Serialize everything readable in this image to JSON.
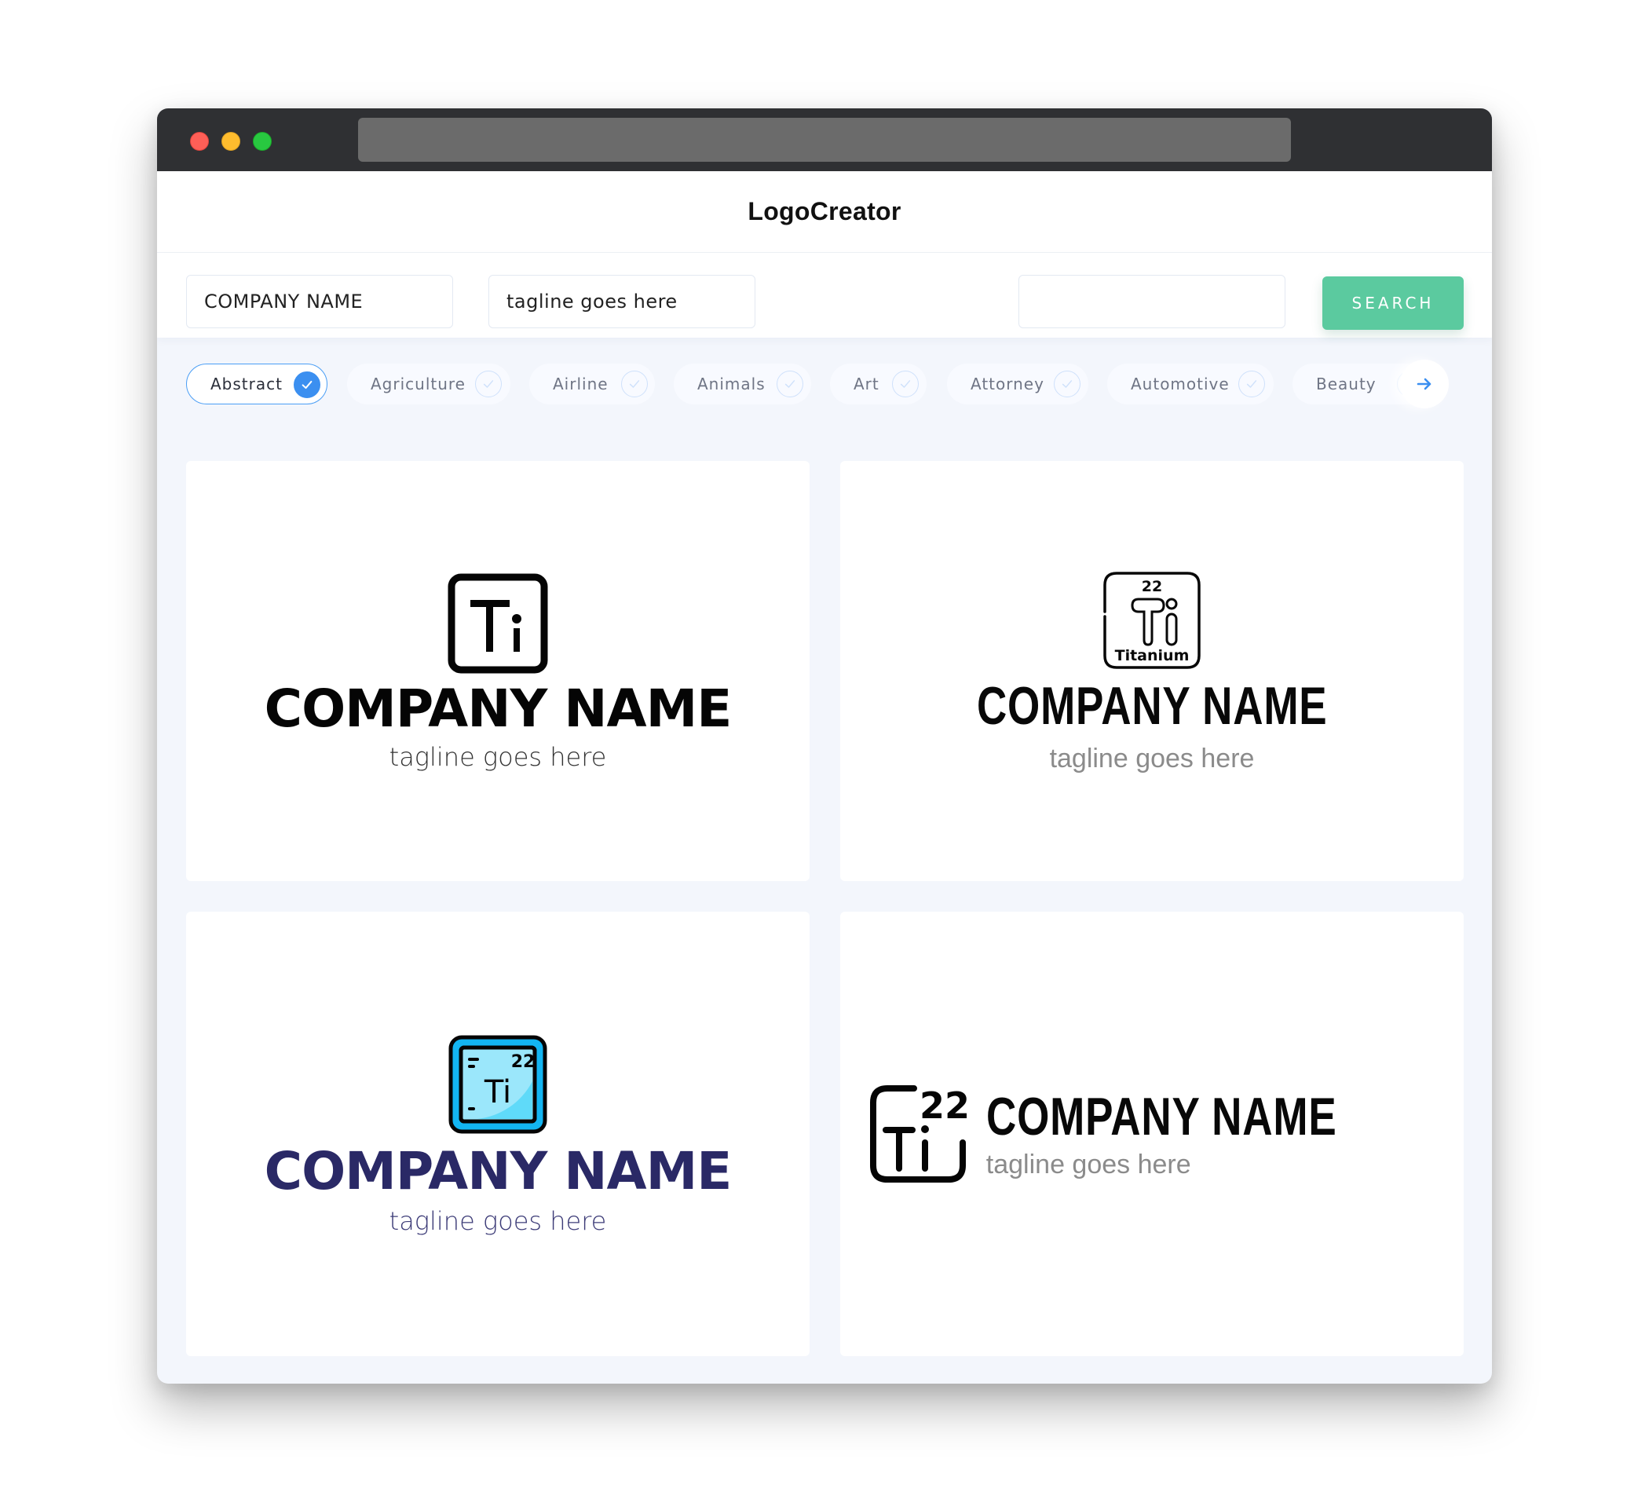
{
  "window": {
    "controls": [
      "close",
      "minimize",
      "maximize"
    ],
    "colors": {
      "close": "#fe5f57",
      "minimize": "#febc2e",
      "maximize": "#28c840"
    }
  },
  "header": {
    "title": "LogoCreator"
  },
  "search": {
    "company_name_value": "COMPANY NAME",
    "tagline_value": "tagline goes here",
    "keyword_value": "",
    "button_label": "SEARCH",
    "button_color": "#5bca9f"
  },
  "categories": {
    "items": [
      {
        "label": "Abstract",
        "selected": true
      },
      {
        "label": "Agriculture",
        "selected": false
      },
      {
        "label": "Airline",
        "selected": false
      },
      {
        "label": "Animals",
        "selected": false
      },
      {
        "label": "Art",
        "selected": false
      },
      {
        "label": "Attorney",
        "selected": false
      },
      {
        "label": "Automotive",
        "selected": false
      },
      {
        "label": "Beauty",
        "selected": false
      }
    ],
    "next_icon": "arrow-right-icon",
    "accent_color": "#3b8ff0"
  },
  "logos": [
    {
      "icon": "titanium-element-square-icon",
      "symbol": "Ti",
      "company": "COMPANY NAME",
      "tagline": "tagline goes here",
      "text_color": "#050505"
    },
    {
      "icon": "titanium-element-outline-icon",
      "symbol": "Ti",
      "number": "22",
      "element_name": "Titanium",
      "company": "COMPANY NAME",
      "tagline": "tagline goes here",
      "text_color": "#080808"
    },
    {
      "icon": "titanium-element-blue-tile-icon",
      "symbol": "Ti",
      "number": "22",
      "company": "COMPANY NAME",
      "tagline": "tagline goes here",
      "text_color": "#2a2966",
      "icon_colors": {
        "outer": "#13b5f2",
        "inner": "#9be7fb"
      }
    },
    {
      "icon": "titanium-element-bracket-icon",
      "symbol": "Ti",
      "number": "22",
      "company": "COMPANY NAME",
      "tagline": "tagline goes here",
      "text_color": "#080808"
    }
  ]
}
